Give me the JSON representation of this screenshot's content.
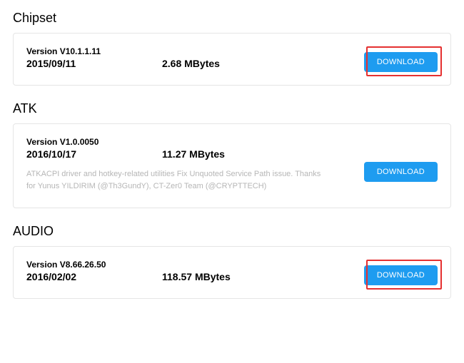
{
  "download_label": "DOWNLOAD",
  "sections": [
    {
      "title": "Chipset",
      "version_label": "Version V10.1.1.11",
      "date": "2015/09/11",
      "size": "2.68 MBytes",
      "description": "",
      "highlighted": true
    },
    {
      "title": "ATK",
      "version_label": "Version V1.0.0050",
      "date": "2016/10/17",
      "size": "11.27 MBytes",
      "description": "ATKACPI driver and hotkey-related utilities Fix Unquoted Service Path issue. Thanks for Yunus YILDIRIM (@Th3GundY), CT-Zer0 Team (@CRYPTTECH)",
      "highlighted": false
    },
    {
      "title": "AUDIO",
      "version_label": "Version V8.66.26.50",
      "date": "2016/02/02",
      "size": "118.57 MBytes",
      "description": "",
      "highlighted": true
    }
  ]
}
